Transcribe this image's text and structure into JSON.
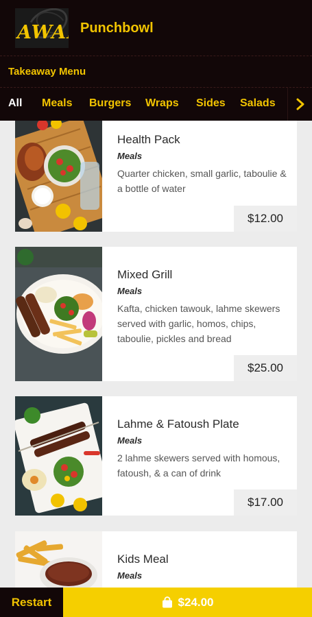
{
  "header": {
    "logo_text": "AWAFI",
    "store_name": "Punchbowl",
    "menu_title": "Takeaway Menu"
  },
  "tabs": [
    {
      "label": "All",
      "active": true
    },
    {
      "label": "Meals"
    },
    {
      "label": "Burgers"
    },
    {
      "label": "Wraps"
    },
    {
      "label": "Sides"
    },
    {
      "label": "Salads"
    }
  ],
  "tabs_more_icon": "chevron-right-icon",
  "items": [
    {
      "name": "Health Pack",
      "category": "Meals",
      "description": "Quarter chicken, small garlic, taboulie & a bottle of water",
      "price": "$12.00"
    },
    {
      "name": "Mixed Grill",
      "category": "Meals",
      "description": "Kafta, chicken tawouk, lahme skewers served with garlic, homos, chips, taboulie, pickles and bread",
      "price": "$25.00"
    },
    {
      "name": "Lahme & Fatoush Plate",
      "category": "Meals",
      "description": "2 lahme skewers served with homous, fatoush, & a can of drink",
      "price": "$17.00"
    },
    {
      "name": "Kids Meal",
      "category": "Meals"
    }
  ],
  "bottom": {
    "restart_label": "Restart",
    "cart_icon": "shopping-bag-icon",
    "cart_total": "$24.00"
  },
  "colors": {
    "header_bg": "#120708",
    "accent": "#f2c400",
    "cart_bg": "#f5cf00"
  }
}
